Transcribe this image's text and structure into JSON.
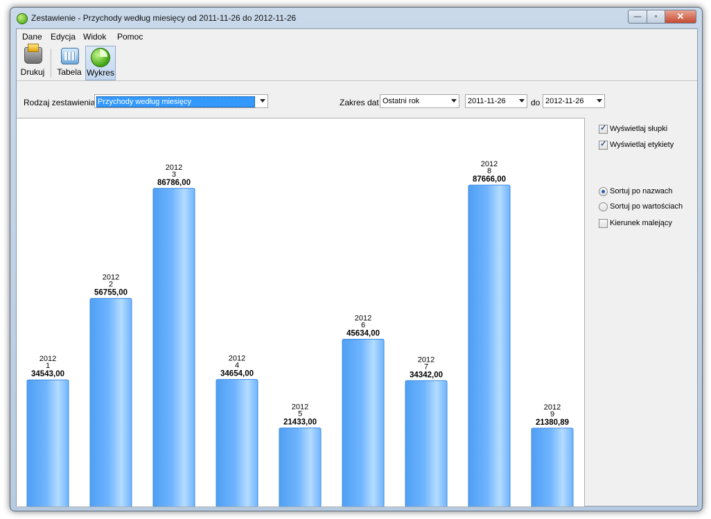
{
  "window": {
    "title": "Zestawienie - Przychody według miesięcy od 2011-11-26 do 2012-11-26",
    "controls": {
      "minimize": "—",
      "maximize": "▫",
      "close": "✕"
    }
  },
  "menu": [
    "Dane",
    "Edycja",
    "Widok",
    "Pomoc"
  ],
  "toolbar": {
    "print": "Drukuj",
    "table": "Tabela",
    "chart": "Wykres"
  },
  "filters": {
    "report_type_label": "Rodzaj zestawienia",
    "report_type_value": "Przychody według miesięcy",
    "date_range_label": "Zakres dat",
    "date_range_value": "Ostatni rok",
    "date_from": "2011-11-26",
    "to_label": "do",
    "date_to": "2012-11-26"
  },
  "options": {
    "show_bars": {
      "label": "Wyświetlaj słupki",
      "checked": true
    },
    "show_labels": {
      "label": "Wyświetlaj etykiety",
      "checked": true
    },
    "sort_by_name": {
      "label": "Sortuj po nazwach",
      "selected": true
    },
    "sort_by_value": {
      "label": "Sortuj po wartościach",
      "selected": false
    },
    "descending": {
      "label": "Kierunek malejący",
      "checked": false
    }
  },
  "colors": {
    "bar_light": "#b4dcff",
    "bar_mid": "#6fb4ff",
    "bar_dark": "#4f9ff3",
    "bar_edge": "#3f8be0"
  },
  "chart_data": {
    "type": "bar",
    "categories": [
      "2012 1",
      "2012 2",
      "2012 3",
      "2012 4",
      "2012 5",
      "2012 6",
      "2012 7",
      "2012 8",
      "2012 9"
    ],
    "years": [
      "2012",
      "2012",
      "2012",
      "2012",
      "2012",
      "2012",
      "2012",
      "2012",
      "2012"
    ],
    "months": [
      "1",
      "2",
      "3",
      "4",
      "5",
      "6",
      "7",
      "8",
      "9"
    ],
    "values": [
      34543.0,
      56755.0,
      86786.0,
      34654.0,
      21433.0,
      45634.0,
      34342.0,
      87666.0,
      21380.89
    ],
    "value_labels": [
      "34543,00",
      "56755,00",
      "86786,00",
      "34654,00",
      "21433,00",
      "45634,00",
      "34342,00",
      "87666,00",
      "21380,89"
    ],
    "ylim": [
      0,
      96000
    ],
    "grid": false,
    "axes_visible": false
  }
}
